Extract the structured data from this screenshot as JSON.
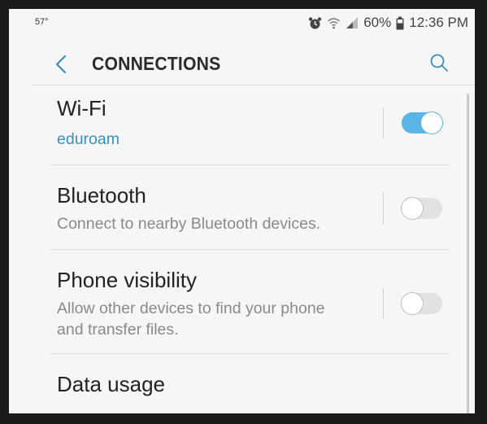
{
  "status_bar": {
    "temperature": "57°",
    "battery": "60%",
    "time": "12:36 PM",
    "icons": [
      "alarm-icon",
      "wifi-icon",
      "signal-icon",
      "battery-icon"
    ]
  },
  "header": {
    "title": "CONNECTIONS",
    "back_icon": "chevron-left-icon",
    "search_icon": "search-icon"
  },
  "settings": {
    "wifi": {
      "title": "Wi-Fi",
      "subtitle": "eduroam",
      "enabled": true
    },
    "bluetooth": {
      "title": "Bluetooth",
      "subtitle": "Connect to nearby Bluetooth devices.",
      "enabled": false
    },
    "phone_visibility": {
      "title": "Phone visibility",
      "subtitle_line1": "Allow other devices to find your phone",
      "subtitle_line2": "and transfer files.",
      "enabled": false
    },
    "data_usage": {
      "title": "Data usage"
    }
  },
  "colors": {
    "accent": "#3b8fbf",
    "toggle_on": "#5ab5e6",
    "toggle_off": "#e2e2e2",
    "background": "#f6f6f6"
  }
}
